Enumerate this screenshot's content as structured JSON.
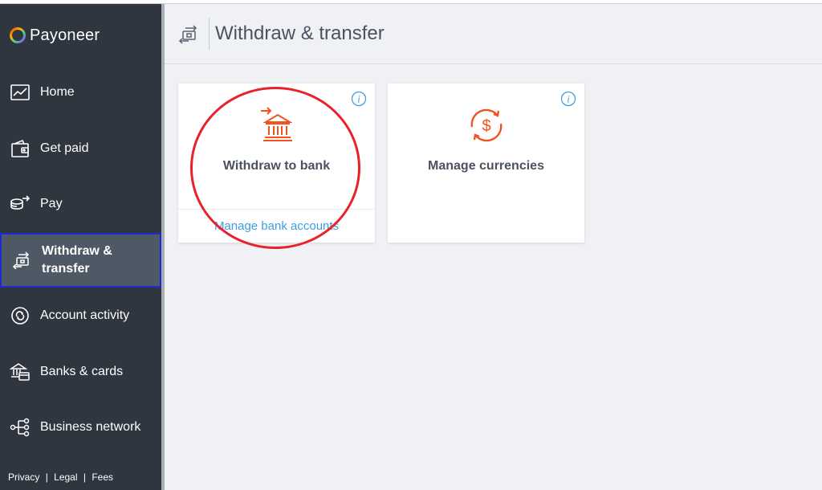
{
  "brand": {
    "name": "Payoneer"
  },
  "sidebar": {
    "items": [
      {
        "label": "Home",
        "icon": "chart-icon"
      },
      {
        "label": "Get paid",
        "icon": "wallet-icon"
      },
      {
        "label": "Pay",
        "icon": "pay-icon"
      },
      {
        "label": "Withdraw & transfer",
        "icon": "transfer-icon",
        "active": true
      },
      {
        "label": "Account activity",
        "icon": "activity-icon"
      },
      {
        "label": "Banks & cards",
        "icon": "bank-card-icon"
      },
      {
        "label": "Business network",
        "icon": "network-icon"
      }
    ],
    "footer": {
      "privacy": "Privacy",
      "legal": "Legal",
      "fees": "Fees",
      "separator": "|"
    }
  },
  "header": {
    "title": "Withdraw & transfer",
    "icon": "transfer-icon"
  },
  "cards": [
    {
      "title": "Withdraw to bank",
      "link": "Manage bank accounts",
      "icon": "bank-withdraw-icon"
    },
    {
      "title": "Manage currencies",
      "icon": "currency-exchange-icon"
    }
  ],
  "colors": {
    "sidebar_bg": "#2f3640",
    "accent_orange": "#f0541e",
    "link_blue": "#3d9fe0",
    "annotation_red": "#e8222b",
    "active_border": "#1a2bd6"
  }
}
